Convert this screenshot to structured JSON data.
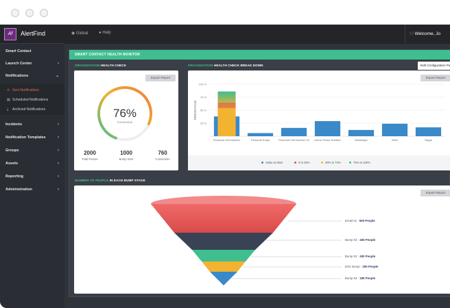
{
  "window": {
    "dots": [
      "",
      "",
      ""
    ]
  },
  "brand": {
    "logo": "Af",
    "name": "AlertFind"
  },
  "topbar": {
    "global": "Global",
    "help": "Help",
    "welcome": "Welcome, Jo"
  },
  "sidebar": {
    "items": [
      {
        "label": "Smart Contact",
        "chevron": ""
      },
      {
        "label": "Launch Center",
        "chevron": "›"
      },
      {
        "label": "Notifications",
        "chevron": "⌄"
      },
      {
        "label": "Incidents",
        "chevron": "›"
      },
      {
        "label": "Notification Templates",
        "chevron": "›"
      },
      {
        "label": "Groups",
        "chevron": "›"
      },
      {
        "label": "Assets",
        "chevron": "›"
      },
      {
        "label": "Reporting",
        "chevron": "›"
      },
      {
        "label": "Administration",
        "chevron": "›"
      }
    ],
    "sub_items": [
      {
        "label": "Sent Notifications",
        "icon": "⟲"
      },
      {
        "label": "Scheduled Notifications",
        "icon": "▤"
      },
      {
        "label": "Archived Notifications",
        "icon": "⤓"
      }
    ]
  },
  "monitor": {
    "title": "SMART CONTACT HEALTH MONITOR"
  },
  "health": {
    "title_accent": "ORGANISATION",
    "title_rest": " HEALTH CHECK",
    "export": "Export Report",
    "percent": "76%",
    "percent_value": 76,
    "caption": "Conversion",
    "stats": [
      {
        "value": "2000",
        "label": "Total Person"
      },
      {
        "value": "1000",
        "label": "Bump Sent"
      },
      {
        "value": "760",
        "label": "Conversion"
      }
    ]
  },
  "breakdown": {
    "title_accent": "ORGANISATION",
    "title_rest": " HEALTH CHECK BREAK DOWN",
    "config": "Edit Configuration Pag",
    "export": "Export Report"
  },
  "chart_data": {
    "type": "bar",
    "ylabel": "PERCENTAGE",
    "ylim": [
      0,
      100
    ],
    "yticks": [
      "100 %",
      "75 %",
      "50 %",
      "25 %"
    ],
    "categories": [
      "Personal Cell Number",
      "Personal Email",
      "Personal Cell Number 02",
      "Home Phone Number",
      "WhatsApp",
      "Viber",
      "Skype"
    ],
    "series": [
      {
        "name": "Value at Start",
        "values": [
          38,
          6,
          16,
          29,
          12,
          24,
          17
        ]
      }
    ],
    "highlight": {
      "category": "Personal Cell Number",
      "value": 86
    },
    "legend": [
      "Value at Start",
      "0 to 25%",
      "26% to 74%",
      "75% to 100%"
    ],
    "legend_colors": [
      "#3a89c9",
      "#e05050",
      "#f2b330",
      "#3fbf8f"
    ],
    "grid": true
  },
  "bump": {
    "title_accent": "NUMBER OF PEOPLE",
    "title_rest": " IN EACH BUMP STAGE",
    "export": "Export Report",
    "stages": [
      {
        "label": "Email 01",
        "value": "500 People"
      },
      {
        "label": "Bump 02",
        "value": "450 People"
      },
      {
        "label": "Bump 02",
        "value": "400 People"
      },
      {
        "label": "ESC Bump",
        "value": "300 People"
      },
      {
        "label": "Bump 04",
        "value": "180 People"
      }
    ]
  },
  "colors": {
    "accent": "#3fbf8f",
    "bar": "#3a89c9",
    "sidebar": "#2a2d33",
    "brand": "#6a2c7a"
  }
}
